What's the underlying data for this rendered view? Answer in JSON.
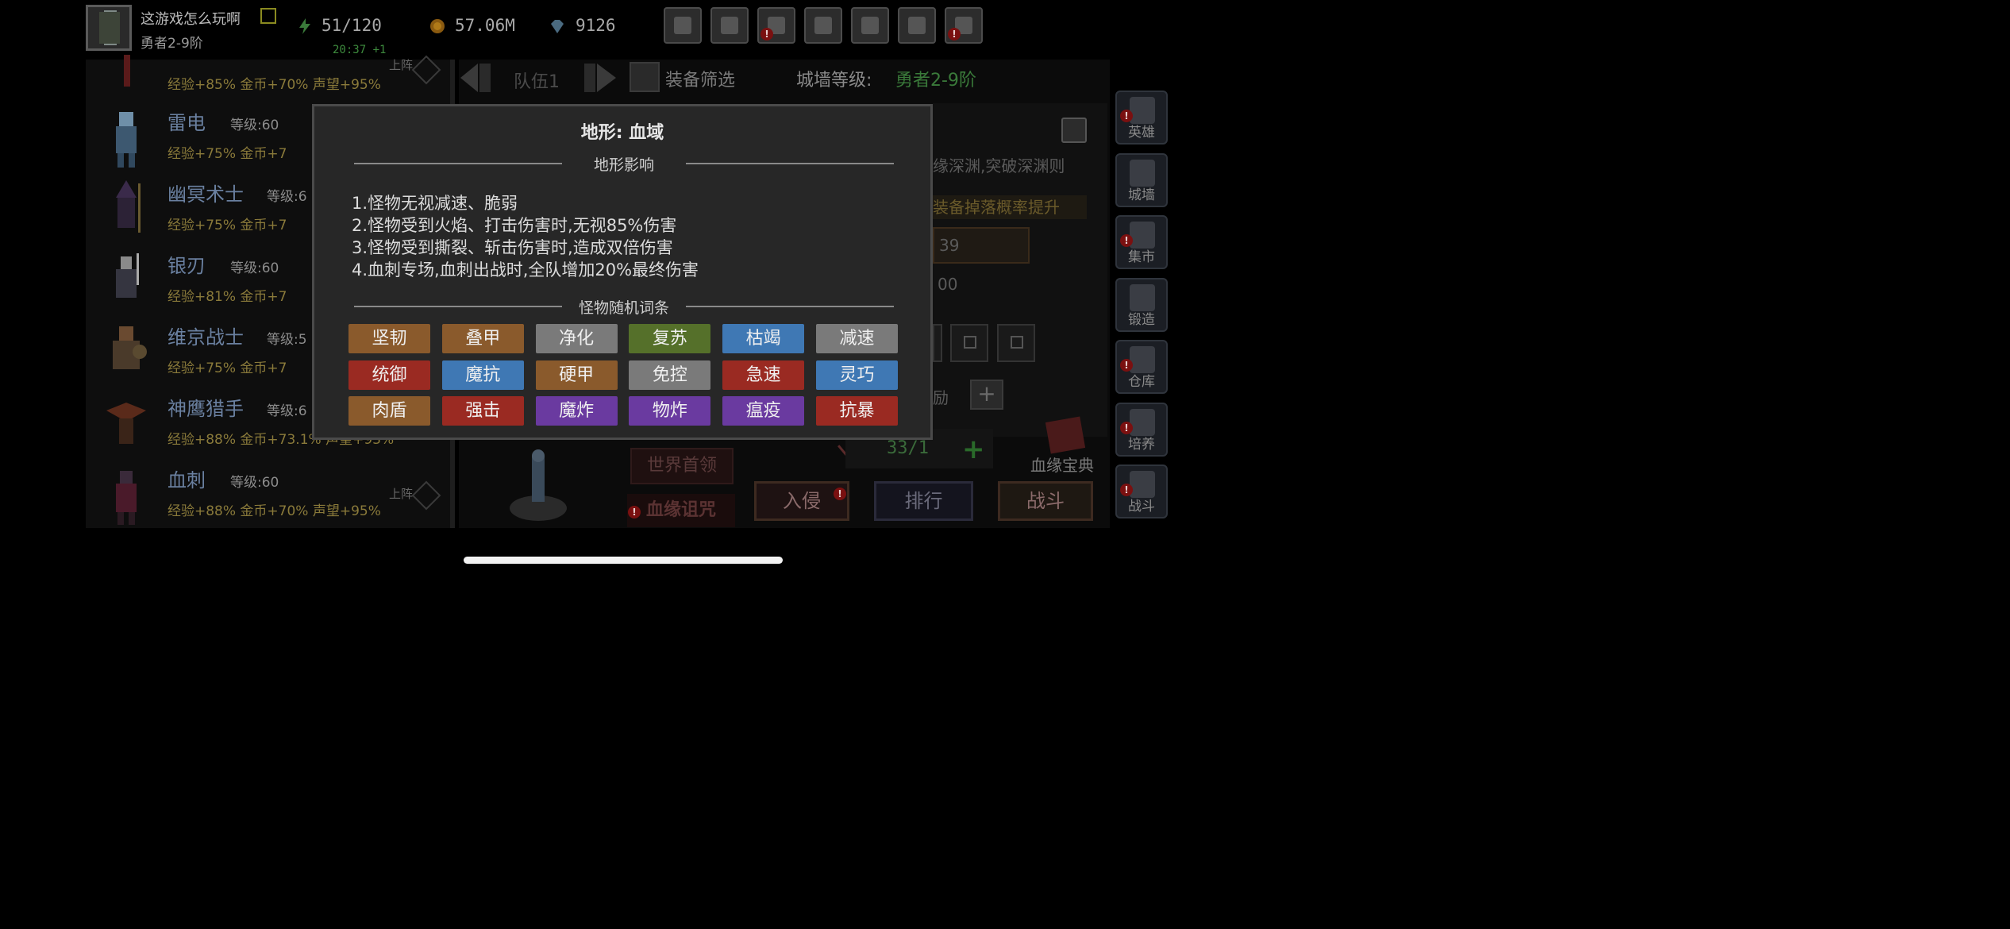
{
  "player": {
    "name": "这游戏怎么玩啊",
    "rank": "勇者2-9阶"
  },
  "resources": {
    "energy": "51/120",
    "energy_timer": "20:37 +1",
    "gold": "57.06M",
    "gems": "9126"
  },
  "top_buttons": [
    {
      "icon": "cart-icon",
      "alert": false
    },
    {
      "icon": "mail-icon",
      "alert": false
    },
    {
      "icon": "gamepad-icon",
      "alert": true
    },
    {
      "icon": "gear-icon",
      "alert": false
    },
    {
      "icon": "gift-icon",
      "alert": false
    },
    {
      "icon": "aperture-icon",
      "alert": false
    },
    {
      "icon": "firework-icon",
      "alert": true
    }
  ],
  "heroes": [
    {
      "name": "",
      "level": "",
      "bonus": "经验+85%   金币+70%   声望+95%",
      "on_team": "上阵"
    },
    {
      "name": "雷电",
      "level": "等级:60",
      "bonus": "经验+75%   金币+7",
      "on_team": ""
    },
    {
      "name": "幽冥术士",
      "level": "等级:6",
      "bonus": "经验+75%   金币+7",
      "on_team": ""
    },
    {
      "name": "银刃",
      "level": "等级:60",
      "bonus": "经验+81%   金币+7",
      "on_team": ""
    },
    {
      "name": "维京战士",
      "level": "等级:5",
      "bonus": "经验+75%   金币+7",
      "on_team": ""
    },
    {
      "name": "神鹰猎手",
      "level": "等级:6",
      "bonus": "经验+88%   金币+73.1%  声望+93%",
      "on_team": ""
    },
    {
      "name": "血刺",
      "level": "等级:60",
      "bonus": "经验+88%   金币+70%   声望+95%",
      "on_team": "上阵"
    }
  ],
  "team_nav": {
    "label": "队伍1"
  },
  "equip_filter": "装备筛选",
  "wall_level": {
    "label": "城墙等级:",
    "value": "勇者2-9阶"
  },
  "background_text": {
    "abyss": "缘深渊,突破深渊则",
    "drop_rate": "装备掉落概率提升",
    "val1": "39",
    "val2": "00",
    "reward": "励",
    "count": "33/1",
    "book": "血缘宝典",
    "world_boss": "世界首领",
    "curse": "血缘诅咒"
  },
  "side_buttons": [
    {
      "label": "英雄",
      "alert": true
    },
    {
      "label": "城墙",
      "alert": false
    },
    {
      "label": "集市",
      "alert": true
    },
    {
      "label": "锻造",
      "alert": false
    },
    {
      "label": "仓库",
      "alert": true
    },
    {
      "label": "培养",
      "alert": true
    },
    {
      "label": "战斗",
      "alert": true
    }
  ],
  "bottom_buttons": {
    "invade": "入侵",
    "rank": "排行",
    "battle": "战斗"
  },
  "modal": {
    "title": "地形: 血域",
    "effects_header": "地形影响",
    "effects": [
      "1.怪物无视减速、脆弱",
      "2.怪物受到火焰、打击伤害时,无视85%伤害",
      "3.怪物受到撕裂、斩击伤害时,造成双倍伤害",
      "4.血刺专场,血刺出战时,全队增加20%最终伤害"
    ],
    "affix_header": "怪物随机词条",
    "affixes": [
      {
        "label": "坚韧",
        "color": "#8a5a2c"
      },
      {
        "label": "叠甲",
        "color": "#8a5a2c"
      },
      {
        "label": "净化",
        "color": "#7a7a7a"
      },
      {
        "label": "复苏",
        "color": "#55702a"
      },
      {
        "label": "枯竭",
        "color": "#3f78b4"
      },
      {
        "label": "减速",
        "color": "#7a7a7a"
      },
      {
        "label": "统御",
        "color": "#9a2a22"
      },
      {
        "label": "魔抗",
        "color": "#3f78b4"
      },
      {
        "label": "硬甲",
        "color": "#8a5a2c"
      },
      {
        "label": "免控",
        "color": "#7a7a7a"
      },
      {
        "label": "急速",
        "color": "#9a2a22"
      },
      {
        "label": "灵巧",
        "color": "#3f78b4"
      },
      {
        "label": "肉盾",
        "color": "#8a5a2c"
      },
      {
        "label": "强击",
        "color": "#9a2a22"
      },
      {
        "label": "魔炸",
        "color": "#6a3aa0"
      },
      {
        "label": "物炸",
        "color": "#6a3aa0"
      },
      {
        "label": "瘟疫",
        "color": "#6a3aa0"
      },
      {
        "label": "抗暴",
        "color": "#9a2a22"
      }
    ]
  }
}
